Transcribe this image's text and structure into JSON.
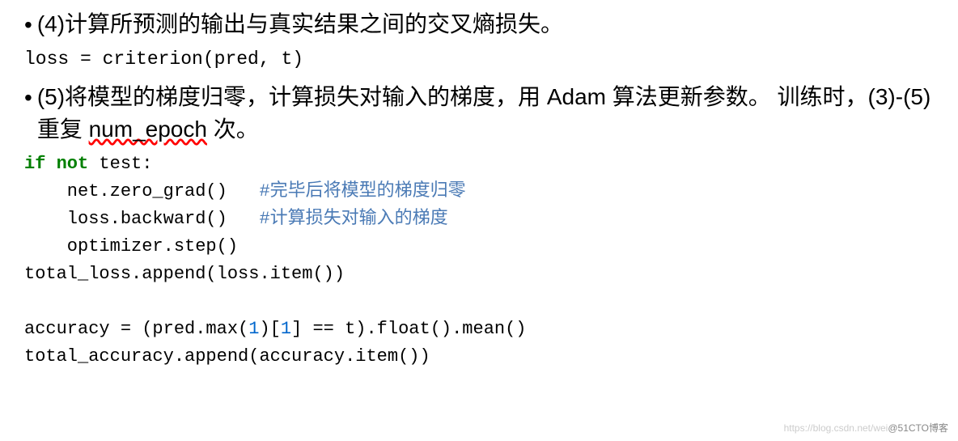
{
  "bullet4": {
    "marker": "•",
    "text": "(4)计算所预测的输出与真实结果之间的交叉熵损失。"
  },
  "code1": "loss = criterion(pred, t)",
  "bullet5": {
    "marker": "•",
    "text_part1": "(5)将模型的梯度归零，计算损失对输入的梯度，用 Adam 算法更新参数。 训练时，(3)-(5)重复 ",
    "underlined": "num_epoch",
    "text_part2": " 次。"
  },
  "code2": {
    "l1_kw1": "if",
    "l1_kw2": "not",
    "l1_rest": " test:",
    "l2_code": "    net.zero_grad()   ",
    "l2_comment": "#完毕后将模型的梯度归零",
    "l3_code": "    loss.backward()   ",
    "l3_comment": "#计算损失对输入的梯度",
    "l4": "    optimizer.step()",
    "l5": "total_loss.append(loss.item())",
    "l6": "",
    "l7_a": "accuracy = (pred.max(",
    "l7_n1": "1",
    "l7_b": ")[",
    "l7_n2": "1",
    "l7_c": "] == t).float().mean()",
    "l8": "total_accuracy.append(accuracy.item())"
  },
  "watermark": {
    "faint": "https://blog.csdn.net/wei",
    "dark": "@51CTO博客"
  }
}
